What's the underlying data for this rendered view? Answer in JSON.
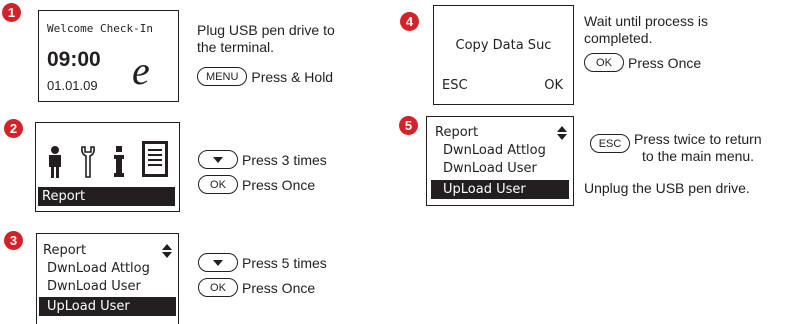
{
  "steps": {
    "s1": {
      "number": "1",
      "screen": {
        "line1": "Welcome Check-In",
        "time": "09:00",
        "date": "01.01.09",
        "logo": "e"
      },
      "instruction": [
        "Plug USB pen drive to",
        "the terminal."
      ],
      "key": "MENU",
      "action": "Press & Hold"
    },
    "s2": {
      "number": "2",
      "screen": {
        "icons": [
          "person-icon",
          "wrench-icon",
          "info-icon",
          "document-icon"
        ],
        "label": "Report"
      },
      "actions": [
        {
          "key_icon": "chevron-down-icon",
          "text": "Press 3 times"
        },
        {
          "key": "OK",
          "text": "Press Once"
        }
      ]
    },
    "s3": {
      "number": "3",
      "screen": {
        "title": "Report",
        "items": [
          "DwnLoad Attlog",
          "DwnLoad User",
          "UpLoad User"
        ],
        "selected": 2
      },
      "actions": [
        {
          "key_icon": "chevron-down-icon",
          "text": "Press 5 times"
        },
        {
          "key": "OK",
          "text": "Press Once"
        }
      ]
    },
    "s4": {
      "number": "4",
      "screen": {
        "message": "Copy Data Suc",
        "left": "ESC",
        "right": "OK"
      },
      "instruction": [
        "Wait until process is",
        "completed."
      ],
      "key": "OK",
      "action": "Press Once"
    },
    "s5": {
      "number": "5",
      "screen": {
        "title": "Report",
        "items": [
          "DwnLoad Attlog",
          "DwnLoad User",
          "UpLoad User"
        ],
        "selected": 2
      },
      "key": "ESC",
      "action": [
        "Press twice to return",
        "to the main menu."
      ],
      "note": "Unplug the USB pen drive."
    }
  },
  "colors": {
    "badge": "#d2232a",
    "ink": "#231f20"
  }
}
